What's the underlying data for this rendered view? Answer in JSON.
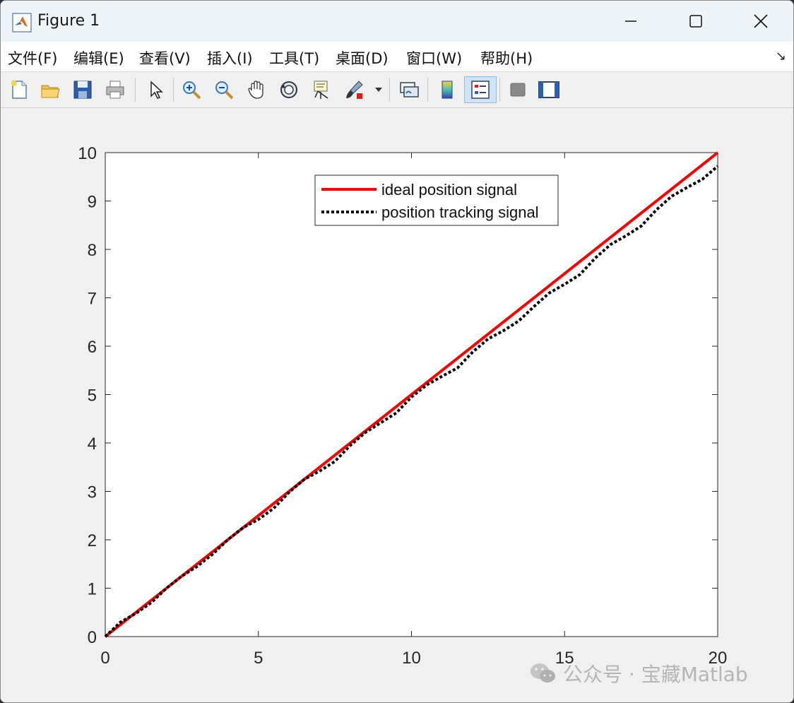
{
  "window": {
    "title": "Figure 1",
    "icon": "matlab-icon"
  },
  "menu": [
    {
      "label": "文件(F)"
    },
    {
      "label": "编辑(E)"
    },
    {
      "label": "查看(V)"
    },
    {
      "label": "插入(I)"
    },
    {
      "label": "工具(T)"
    },
    {
      "label": "桌面(D)"
    },
    {
      "label": "窗口(W)"
    },
    {
      "label": "帮助(H)"
    }
  ],
  "toolbar": [
    {
      "icon": "new-figure-icon"
    },
    {
      "icon": "open-file-icon"
    },
    {
      "icon": "save-icon"
    },
    {
      "icon": "print-icon"
    },
    {
      "icon": "pointer-icon"
    },
    {
      "icon": "zoom-in-icon"
    },
    {
      "icon": "zoom-out-icon"
    },
    {
      "icon": "pan-icon"
    },
    {
      "icon": "rotate-3d-icon"
    },
    {
      "icon": "data-cursor-icon"
    },
    {
      "icon": "brush-icon"
    },
    {
      "icon": "link-plot-icon"
    },
    {
      "icon": "colorbar-icon"
    },
    {
      "icon": "legend-icon",
      "active": true
    },
    {
      "icon": "hide-plot-tools-icon"
    },
    {
      "icon": "show-plot-tools-icon"
    }
  ],
  "chart_data": {
    "type": "line",
    "title": "",
    "xlabel": "",
    "ylabel": "",
    "xlim": [
      0,
      20
    ],
    "ylim": [
      0,
      10
    ],
    "xticks": [
      "0",
      "5",
      "10",
      "15",
      "20"
    ],
    "yticks": [
      "0",
      "1",
      "2",
      "3",
      "4",
      "5",
      "6",
      "7",
      "8",
      "9",
      "10"
    ],
    "grid": false,
    "legend_position": "top-right",
    "series": [
      {
        "name": "ideal position signal",
        "color": "#ff0000",
        "style": "solid",
        "x": [
          0,
          20
        ],
        "y": [
          0,
          10
        ]
      },
      {
        "name": "position tracking signal",
        "color": "#000000",
        "style": "dotted",
        "x": [
          0,
          0.5,
          1,
          1.5,
          2,
          2.5,
          3,
          3.5,
          4,
          4.5,
          5,
          5.5,
          6,
          6.5,
          7,
          7.5,
          8,
          8.5,
          9,
          9.5,
          10,
          10.5,
          11,
          11.5,
          12,
          12.5,
          13,
          13.5,
          14,
          14.5,
          15,
          15.5,
          16,
          16.5,
          17,
          17.5,
          18,
          18.5,
          19,
          19.5,
          20
        ],
        "y": [
          0,
          0.3,
          0.48,
          0.7,
          1.0,
          1.25,
          1.45,
          1.7,
          2.0,
          2.25,
          2.42,
          2.65,
          2.98,
          3.25,
          3.42,
          3.62,
          3.95,
          4.22,
          4.42,
          4.62,
          4.95,
          5.2,
          5.38,
          5.55,
          5.88,
          6.15,
          6.32,
          6.52,
          6.82,
          7.1,
          7.28,
          7.48,
          7.82,
          8.1,
          8.28,
          8.48,
          8.82,
          9.1,
          9.28,
          9.45,
          9.72
        ]
      }
    ]
  },
  "watermark": {
    "text": "公众号 · 宝藏Matlab",
    "icon": "wechat-icon"
  }
}
